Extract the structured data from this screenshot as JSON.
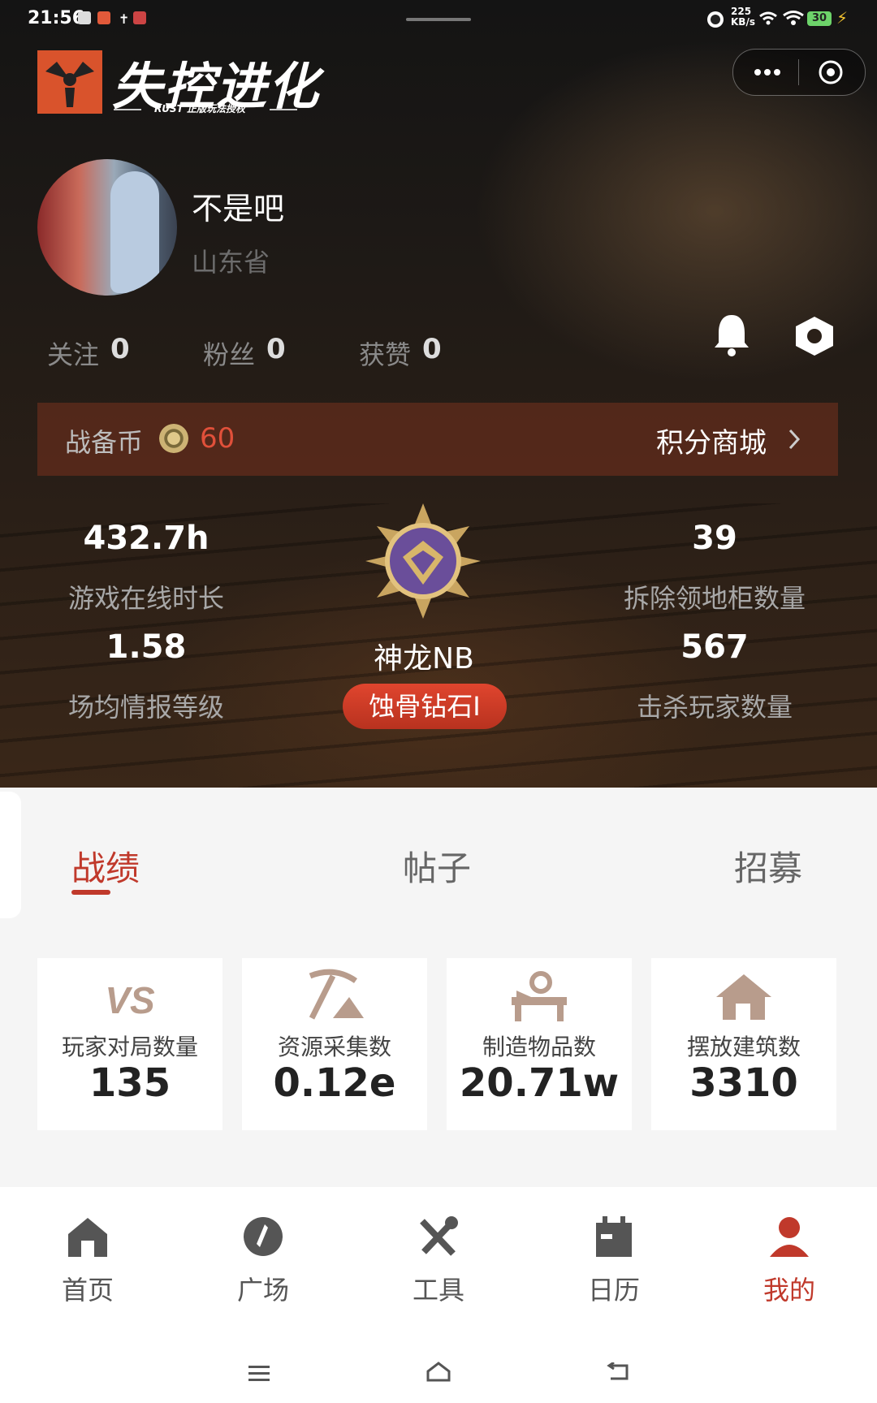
{
  "status_bar": {
    "time": "21:56",
    "speed_value": "225",
    "speed_unit": "KB/s",
    "battery": "30"
  },
  "header": {
    "logo_title": "失控进化",
    "logo_subtitle": "RUST 正版玩法授权",
    "capsule_more_icon": "more-dots-icon",
    "capsule_close_icon": "target-circle-icon"
  },
  "profile": {
    "name": "不是吧",
    "location": "山东省",
    "follow_label": "关注",
    "follow_value": "0",
    "fans_label": "粉丝",
    "fans_value": "0",
    "likes_label": "获赞",
    "likes_value": "0"
  },
  "coins": {
    "label": "战备币",
    "value": "60",
    "shop_label": "积分商城"
  },
  "stats": {
    "online_value": "432.7h",
    "online_label": "游戏在线时长",
    "intel_value": "1.58",
    "intel_label": "场均情报等级",
    "cabinet_value": "39",
    "cabinet_label": "拆除领地柜数量",
    "kills_value": "567",
    "kills_label": "击杀玩家数量",
    "rank_name": "神龙NB",
    "rank_tier": "蚀骨钻石I"
  },
  "tabs": {
    "record": "战绩",
    "posts": "帖子",
    "recruit": "招募"
  },
  "cards": [
    {
      "icon": "vs-icon",
      "label": "玩家对局数量",
      "value": "135"
    },
    {
      "icon": "pickaxe-icon",
      "label": "资源采集数",
      "value": "0.12e"
    },
    {
      "icon": "workbench-icon",
      "label": "制造物品数",
      "value": "20.71w"
    },
    {
      "icon": "house-icon",
      "label": "摆放建筑数",
      "value": "3310"
    }
  ],
  "nav": {
    "home": "首页",
    "square": "广场",
    "tools": "工具",
    "calendar": "日历",
    "mine": "我的"
  },
  "colors": {
    "accent": "#c0392b",
    "coin_value": "#e0503a",
    "logo_orange": "#d9532c"
  }
}
